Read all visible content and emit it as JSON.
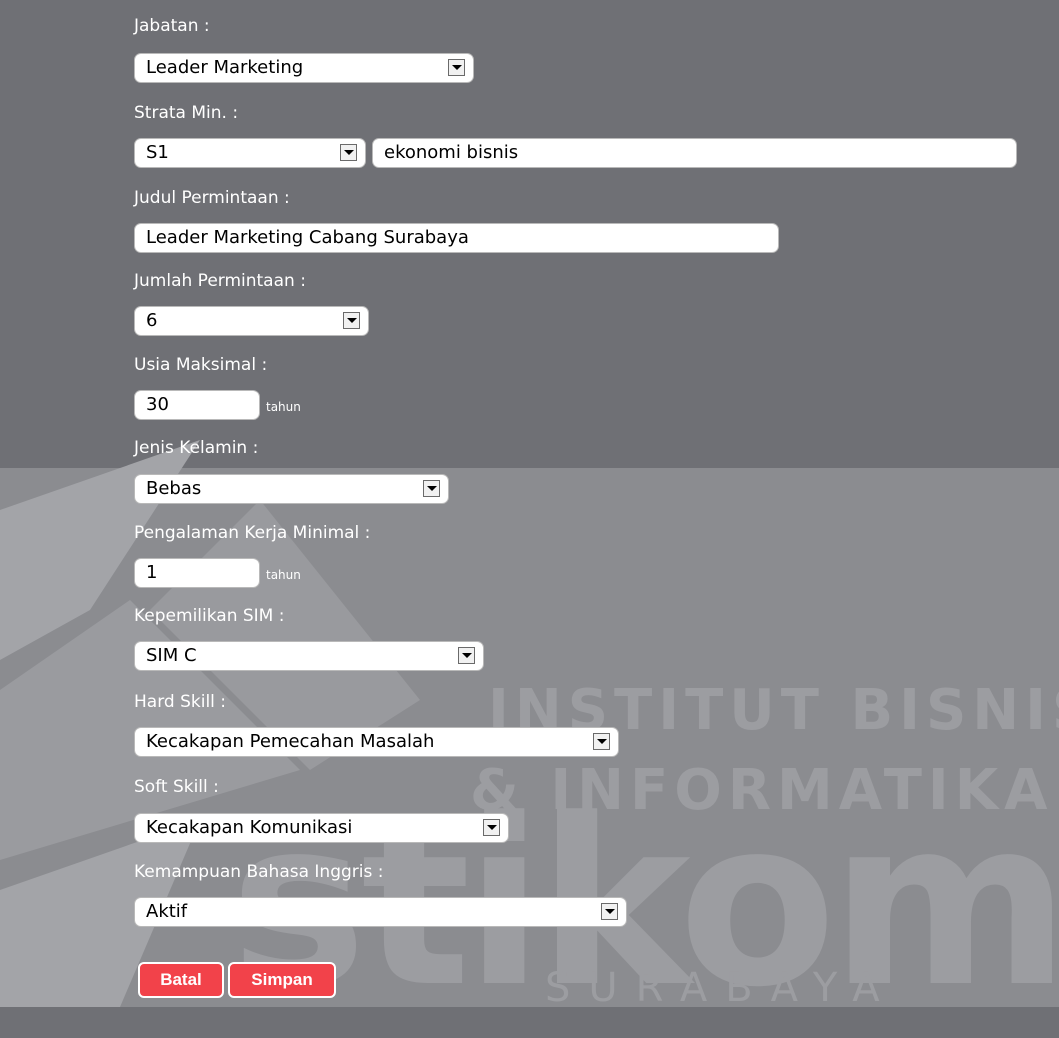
{
  "watermark": {
    "line1": "INSTITUT BISNIS",
    "line2": "& INFORMATIKA",
    "logo": "stikom",
    "city": "SURABAYA"
  },
  "form": {
    "jabatan": {
      "label": "Jabatan :",
      "value": "Leader Marketing"
    },
    "strata": {
      "label": "Strata Min. :",
      "value": "S1",
      "jurusan": "ekonomi bisnis"
    },
    "judul": {
      "label": "Judul Permintaan :",
      "value": "Leader Marketing Cabang Surabaya"
    },
    "jumlah": {
      "label": "Jumlah Permintaan :",
      "value": "6"
    },
    "usia": {
      "label": "Usia Maksimal :",
      "value": "30",
      "unit": "tahun"
    },
    "kelamin": {
      "label": "Jenis Kelamin :",
      "value": "Bebas"
    },
    "pengalaman": {
      "label": "Pengalaman Kerja Minimal :",
      "value": "1",
      "unit": "tahun"
    },
    "sim": {
      "label": "Kepemilikan SIM :",
      "value": "SIM C"
    },
    "hard_skill": {
      "label": "Hard Skill :",
      "value": "Kecakapan Pemecahan Masalah"
    },
    "soft_skill": {
      "label": "Soft Skill :",
      "value": "Kecakapan Komunikasi"
    },
    "bahasa": {
      "label": "Kemampuan Bahasa Inggris :",
      "value": "Aktif"
    }
  },
  "buttons": {
    "batal": "Batal",
    "simpan": "Simpan"
  }
}
